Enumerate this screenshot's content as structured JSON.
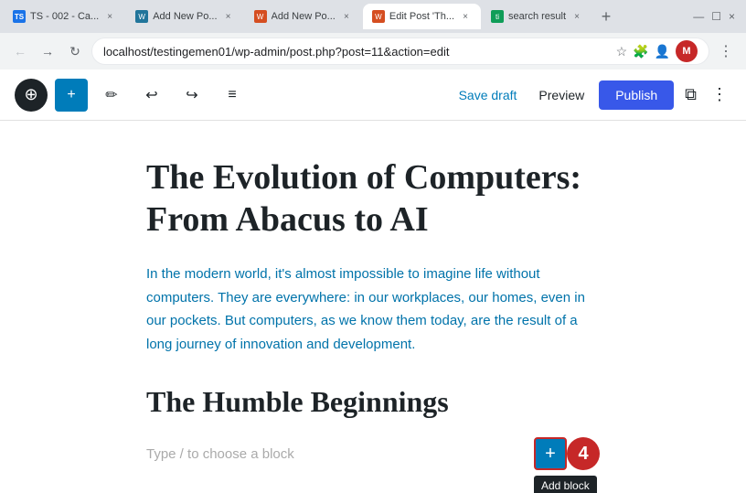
{
  "browser": {
    "tabs": [
      {
        "id": "tab1",
        "label": "TS - 002 - Ca...",
        "favicon_type": "ts",
        "favicon_text": "TS",
        "active": false
      },
      {
        "id": "tab2",
        "label": "Add New Po...",
        "favicon_type": "wp-blue",
        "favicon_text": "W",
        "active": false
      },
      {
        "id": "tab3",
        "label": "Add New Po...",
        "favicon_type": "wp-red",
        "favicon_text": "W",
        "active": false
      },
      {
        "id": "tab4",
        "label": "Edit Post 'Th...",
        "favicon_type": "edit",
        "favicon_text": "W",
        "active": true
      },
      {
        "id": "tab5",
        "label": "search result",
        "favicon_type": "search",
        "favicon_text": "ti",
        "active": false
      }
    ],
    "url": "localhost/testingemen01/wp-admin/post.php?post=11&action=edit",
    "profile_initial": "M"
  },
  "toolbar": {
    "add_label": "+",
    "save_draft_label": "Save draft",
    "preview_label": "Preview",
    "publish_label": "Publish",
    "undo_icon": "↩",
    "redo_icon": "↪",
    "list_icon": "≡",
    "edit_icon": "✏"
  },
  "editor": {
    "title": "The Evolution of Computers:\nFrom Abacus to AI",
    "intro": "In the modern world, it's almost impossible to imagine life without computers. They are everywhere: in our workplaces, our homes, even in our pockets. But computers, as we know them today, are the result of a long journey of innovation and development.",
    "section_heading": "The Humble Beginnings",
    "block_placeholder": "Type / to choose a block",
    "add_block_label": "Add block",
    "step_number": "4"
  }
}
